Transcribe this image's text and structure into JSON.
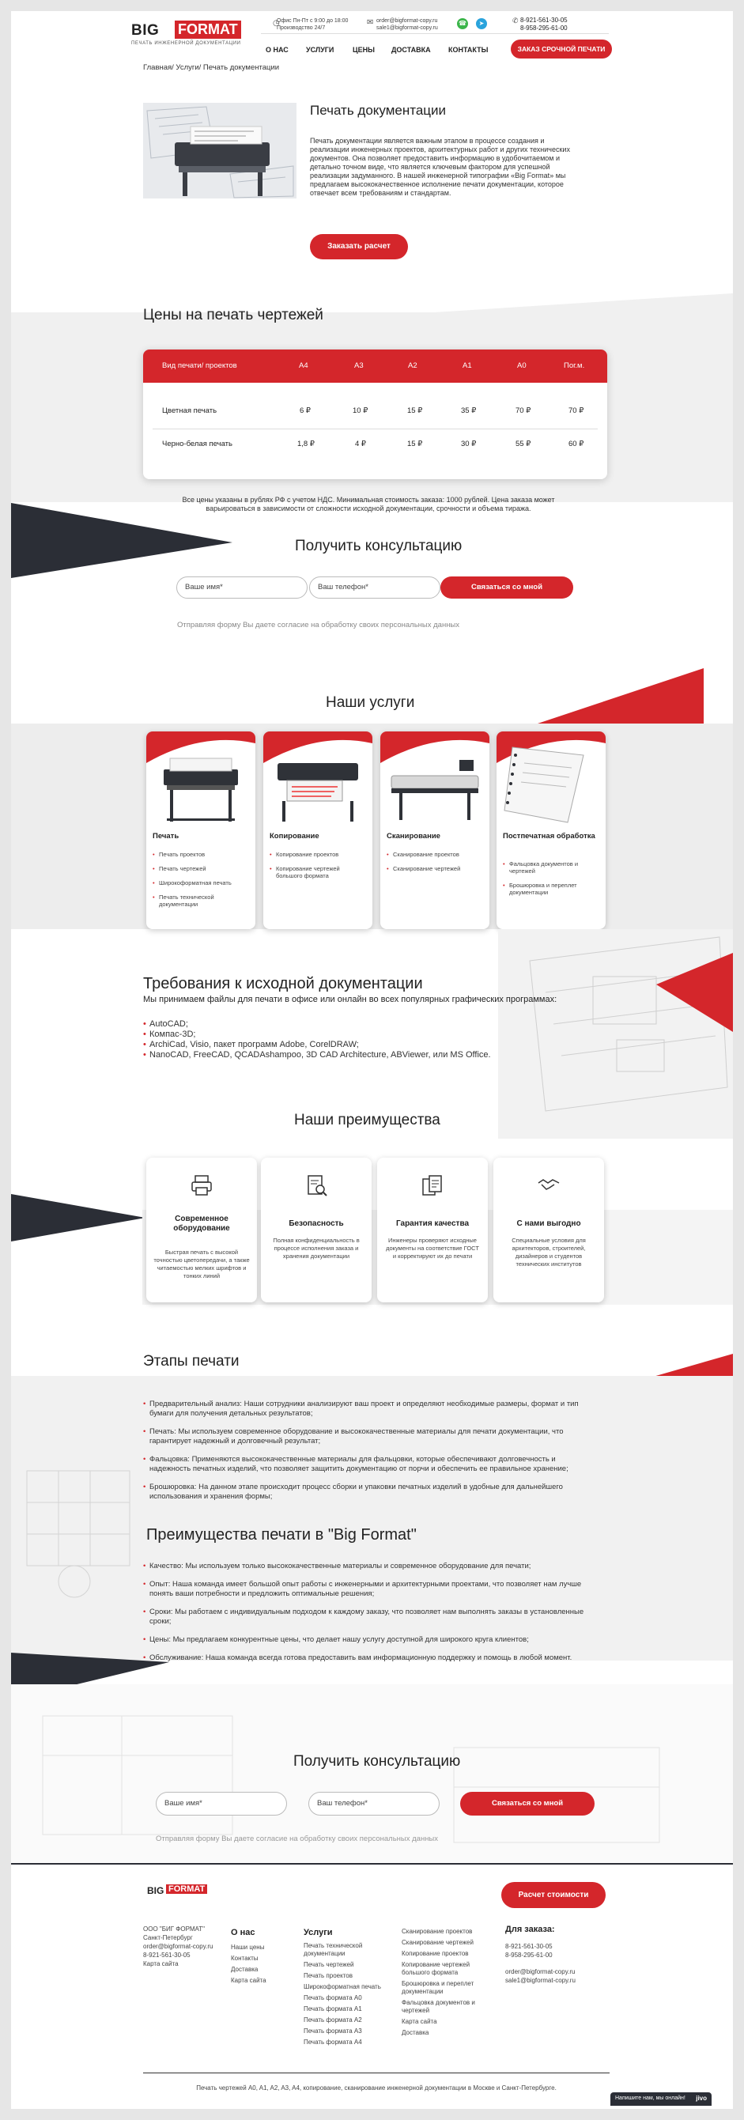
{
  "header": {
    "logo_big": "BIG",
    "logo_format": "FORMAT",
    "logo_tagline": "печать инженерной документации",
    "hours_line1": "Офис Пн-Пт с 9:00 до 18:00",
    "hours_line2": "Производство 24/7",
    "email1": "order@bigformat-copy.ru",
    "email2": "sale1@bigformat-copy.ru",
    "phone1": "8-921-561-30-05",
    "phone2": "8-958-295-61-00",
    "nav": [
      "О НАС",
      "УСЛУГИ",
      "ЦЕНЫ",
      "ДОСТАВКА",
      "КОНТАКТЫ"
    ],
    "urgent_button": "ЗАКАЗ СРОЧНОЙ ПЕЧАТИ"
  },
  "breadcrumb": "Главная/ Услуги/ Печать документации",
  "hero": {
    "title": "Печать документации",
    "text": "Печать документации является важным этапом в процессе создания и реализации инженерных проектов, архитектурных работ и других технических документов. Она позволяет предоставить информацию в удобочитаемом и детально точном виде, что является ключевым фактором для успешной реализации задуманного. В нашей инженерной типографии «Big Format» мы предлагаем высококачественное исполнение печати документации, которое отвечает всем требованиям и стандартам.",
    "button": "Заказать расчет"
  },
  "prices": {
    "title": "Цены на печать чертежей",
    "headers": [
      "Вид печати/ проектов",
      "A4",
      "A3",
      "A2",
      "A1",
      "A0",
      "Пог.м."
    ],
    "rows": [
      [
        "Цветная печать",
        "6 ₽",
        "10 ₽",
        "15 ₽",
        "35 ₽",
        "70 ₽",
        "70 ₽"
      ],
      [
        "Черно-белая печать",
        "1,8 ₽",
        "4 ₽",
        "15 ₽",
        "30 ₽",
        "55 ₽",
        "60 ₽"
      ]
    ],
    "note": "Все цены указаны в рублях РФ с учетом НДС. Минимальная стоимость заказа: 1000 рублей. Цена заказа может варьироваться в зависимости от сложности исходной документации, срочности и объема тиража."
  },
  "consult1": {
    "title": "Получить консультацию",
    "name_placeholder": "Ваше имя*",
    "phone_placeholder": "Ваш телефон*",
    "button": "Связаться со мной",
    "consent": "Отправляя форму Вы даете согласие на обработку своих персональных данных"
  },
  "services": {
    "title": "Наши услуги",
    "cards": [
      {
        "title": "Печать",
        "items": [
          "Печать проектов",
          "Печать чертежей",
          "Широкоформатная печать",
          "Печать технической документации"
        ]
      },
      {
        "title": "Копирование",
        "items": [
          "Копирование проектов",
          "Копирование чертежей большого формата"
        ]
      },
      {
        "title": "Сканирование",
        "items": [
          "Сканирование проектов",
          "Сканирование чертежей"
        ]
      },
      {
        "title": "Постпечатная обработка",
        "items": [
          "Фальцовка документов и чертежей",
          "Брошюровка и переплет документации"
        ]
      }
    ]
  },
  "requirements": {
    "title": "Требования к исходной документации",
    "intro": "Мы принимаем файлы для печати в офисе или онлайн во всех популярных графических программах:",
    "items": [
      "AutoCAD;",
      "Компас-3D;",
      "ArchiCad, Visio, пакет программ Adobe, CorelDRAW;",
      "NanoCAD, FreeCAD, QCADAshampoo, 3D CAD Architecture, ABViewer, или MS Office."
    ]
  },
  "advantages": {
    "title": "Наши преимущества",
    "cards": [
      {
        "title": "Современное оборудование",
        "text": "Быстрая печать с высокой точностью цветопередачи, а также читаемостью мелких шрифтов и тонких линий"
      },
      {
        "title": "Безопасность",
        "text": "Полная конфиденциальность в процессе исполнения заказа и хранения документации"
      },
      {
        "title": "Гарантия качества",
        "text": "Инженеры проверяют исходные документы на соответствие ГОСТ и корректируют их до печати"
      },
      {
        "title": "С нами выгодно",
        "text": "Специальные условия для архитекторов, строителей, дизайнеров и студентов технических институтов"
      }
    ]
  },
  "stages": {
    "title": "Этапы печати",
    "items": [
      "Предварительный анализ: Наши сотрудники анализируют ваш проект и определяют необходимые размеры, формат и тип бумаги для получения детальных результатов;",
      "Печать: Мы используем современное оборудование и высококачественные материалы для печати документации, что гарантирует надежный и долговечный результат;",
      "Фальцовка: Применяются высококачественные материалы для фальцовки, которые обеспечивают долговечность и надежность печатных изделий, что позволяет защитить документацию от порчи и обеспечить ее правильное хранение;",
      "Брошюровка: На данном этапе происходит процесс сборки и упаковки печатных изделий в удобные для дальнейшего использования и хранения формы;"
    ]
  },
  "benefits": {
    "title": "Преимущества печати в \"Big Format\"",
    "items": [
      "Качество: Мы используем только высококачественные материалы и современное оборудование для печати;",
      "Опыт: Наша команда имеет большой опыт работы с инженерными и архитектурными проектами, что позволяет нам лучше понять ваши потребности и предложить оптимальные решения;",
      "Сроки: Мы работаем с индивидуальным подходом к каждому заказу, что позволяет нам выполнять заказы в установленные сроки;",
      "Цены: Мы предлагаем конкурентные цены, что делает нашу услугу доступной для широкого круга клиентов;",
      "Обслуживание: Наша команда всегда готова предоставить вам информационную поддержку и помощь в любой момент."
    ]
  },
  "consult2": {
    "title": "Получить консультацию",
    "name_placeholder": "Ваше имя*",
    "phone_placeholder": "Ваш телефон*",
    "button": "Связаться со мной",
    "consent": "Отправляя форму Вы даете согласие на обработку своих персональных данных"
  },
  "footer": {
    "calc_button": "Расчет стоимости",
    "company": [
      "ООО \"БИГ ФОРМАТ\"",
      "Санкт-Петербург",
      "order@bigformat-copy.ru",
      "8-921-561-30-05",
      "Карта сайта"
    ],
    "about_title": "О нас",
    "about_links": [
      "Наши цены",
      "Контакты",
      "Доставка",
      "Карта сайта"
    ],
    "services_title": "Услуги",
    "services_links": [
      "Печать технической документации",
      "Печать чертежей",
      "Печать проектов",
      "Широкоформатная печать",
      "Печать формата A0",
      "Печать формата A1",
      "Печать формата A2",
      "Печать формата A3",
      "Печать формата A4"
    ],
    "services_links2": [
      "Сканирование проектов",
      "Сканирование чертежей",
      "Копирование проектов",
      "Копирование чертежей большого формата",
      "Брошюровка и переплет документации",
      "Фальцовка документов и чертежей",
      "Карта сайта",
      "Доставка"
    ],
    "order_title": "Для заказа:",
    "order_lines": [
      "8-921-561-30-05",
      "8-958-295-61-00",
      "order@bigformat-copy.ru",
      "sale1@bigformat-copy.ru"
    ],
    "bottom_text": "Печать чертежей A0, A1, A2, A3, A4, копирование, сканирование инженерной документации в Москве и Санкт-Петербурге.",
    "chat_label": "Напишите нам, мы онлайн!",
    "chat_brand": "jivo"
  },
  "colors": {
    "accent": "#d4262b",
    "dark": "#2b2e36",
    "grey_band": "#f0f0f0"
  }
}
